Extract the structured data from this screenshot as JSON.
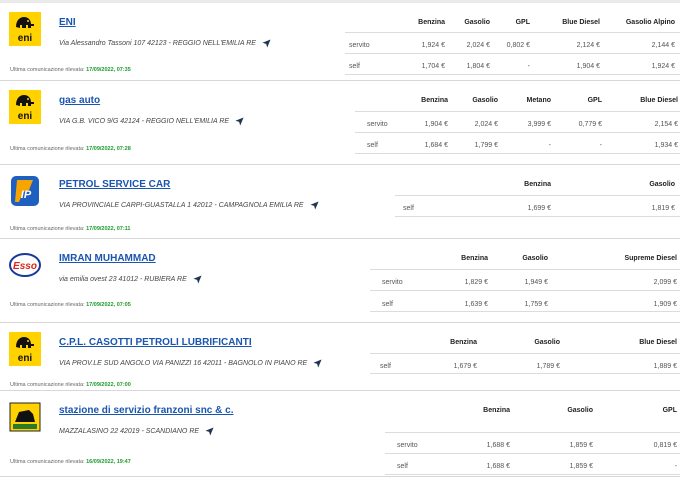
{
  "comm_prefix": "Ultima comunicazione rilevata:",
  "stations": [
    {
      "brand": "eni",
      "name": "ENI",
      "address": "Via Alessandro Tassoni 107 42123 - REGGIO NELL'EMILIA RE",
      "last_update": "17/09/2022, 07:35",
      "headers": [
        "Benzina",
        "Gasolio",
        "GPL",
        "Blue Diesel",
        "Gasolio Alpino"
      ],
      "rows": [
        {
          "label": "servito",
          "values": [
            "1,924 €",
            "2,024 €",
            "0,802 €",
            "2,124 €",
            "2,144 €"
          ]
        },
        {
          "label": "self",
          "values": [
            "1,704 €",
            "1,804 €",
            "-",
            "1,904 €",
            "1,924 €"
          ]
        }
      ]
    },
    {
      "brand": "eni",
      "name": "gas auto",
      "address": "VIA G.B. VICO 9/G 42124 - REGGIO NELL'EMILIA RE",
      "last_update": "17/09/2022, 07:28",
      "headers": [
        "Benzina",
        "Gasolio",
        "Metano",
        "GPL",
        "Blue Diesel"
      ],
      "rows": [
        {
          "label": "servito",
          "values": [
            "1,904 €",
            "2,024 €",
            "3,999 €",
            "0,779 €",
            "2,154 €"
          ]
        },
        {
          "label": "self",
          "values": [
            "1,684 €",
            "1,799 €",
            "-",
            "-",
            "1,934 €"
          ]
        }
      ]
    },
    {
      "brand": "ip",
      "name": "PETROL SERVICE CAR",
      "address": "VIA PROVINCIALE CARPI-GUASTALLA 1 42012 - CAMPAGNOLA EMILIA RE",
      "last_update": "17/09/2022, 07:11",
      "headers": [
        "Benzina",
        "Gasolio"
      ],
      "rows": [
        {
          "label": "self",
          "values": [
            "1,699 €",
            "1,819 €"
          ]
        }
      ]
    },
    {
      "brand": "esso",
      "name": "IMRAN MUHAMMAD",
      "address": "via emilia ovest 23 41012 - RUBIERA RE",
      "last_update": "17/09/2022, 07:05",
      "headers": [
        "Benzina",
        "Gasolio",
        "Supreme Diesel"
      ],
      "rows": [
        {
          "label": "servito",
          "values": [
            "1,829 €",
            "1,949 €",
            "2,099 €"
          ]
        },
        {
          "label": "self",
          "values": [
            "1,639 €",
            "1,759 €",
            "1,909 €"
          ]
        }
      ]
    },
    {
      "brand": "eni",
      "name": "C.P.L. CASOTTI PETROLI LUBRIFICANTI",
      "address": "VIA PROV.LE SUD ANGOLO VIA PANIZZI 16 42011 - BAGNOLO IN PIANO RE",
      "last_update": "17/09/2022, 07:00",
      "headers": [
        "Benzina",
        "Gasolio",
        "Blue Diesel"
      ],
      "rows": [
        {
          "label": "self",
          "values": [
            "1,679 €",
            "1,789 €",
            "1,889 €"
          ]
        }
      ]
    },
    {
      "brand": "pompa",
      "name": "stazione di servizio franzoni snc & c.",
      "address": "MAZZALASINO 22 42019 - SCANDIANO RE",
      "last_update": "16/09/2022, 19:47",
      "headers": [
        "Benzina",
        "Gasolio",
        "GPL"
      ],
      "rows": [
        {
          "label": "servito",
          "values": [
            "1,688 €",
            "1,859 €",
            "0,819 €"
          ]
        },
        {
          "label": "self",
          "values": [
            "1,688 €",
            "1,859 €",
            "-"
          ]
        }
      ]
    }
  ]
}
